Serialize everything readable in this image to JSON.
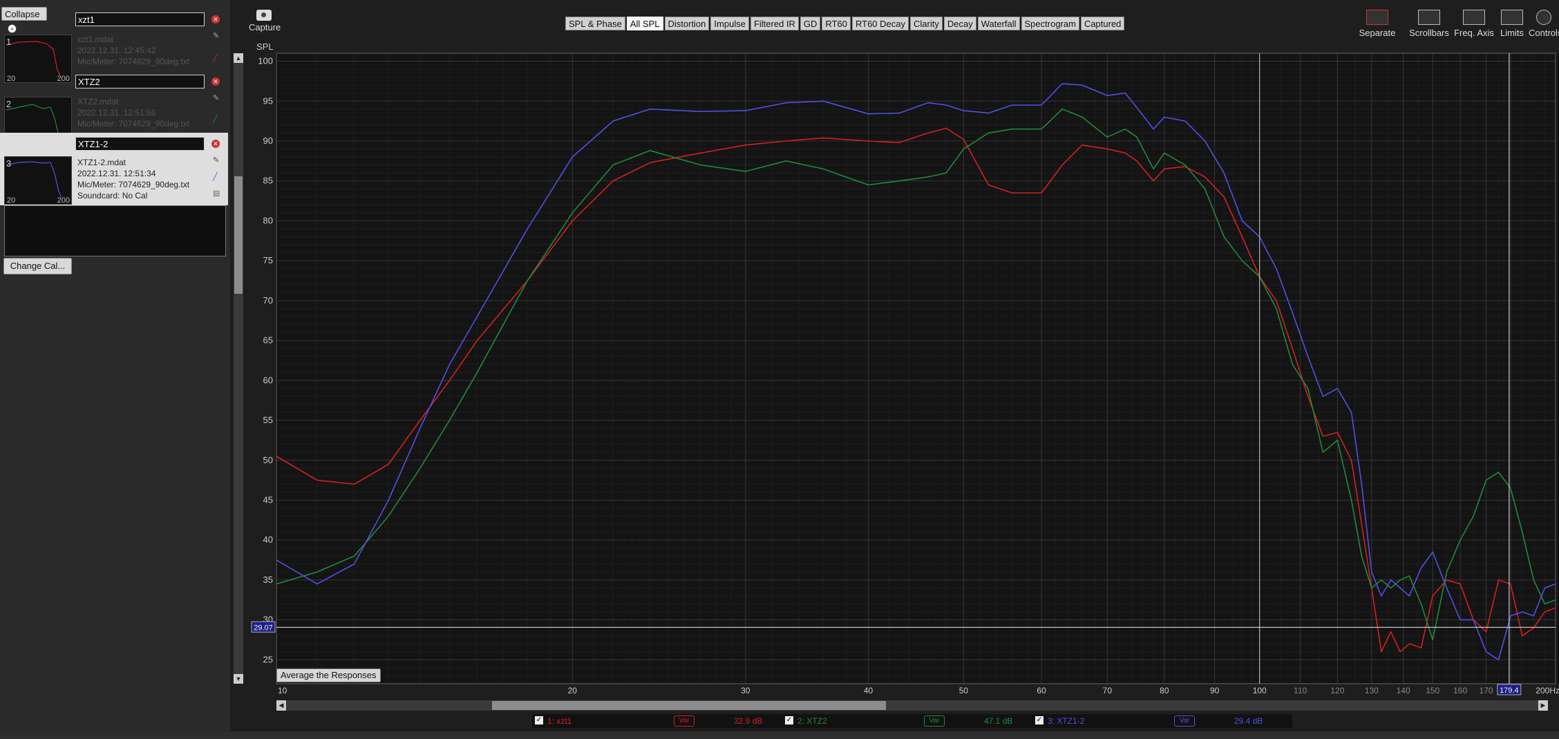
{
  "left_panel": {
    "collapse_label": "Collapse",
    "change_cal_label": "Change Cal...",
    "measurements": [
      {
        "num": "1",
        "name": "xzt1",
        "file": "xzt1.mdat",
        "date": "2022.12.31. 12:45:42",
        "mic": "Mic/Meter: 7074629_90deg.txt",
        "x_min": "20",
        "x_max": "200",
        "color": "#d42020"
      },
      {
        "num": "2",
        "name": "XTZ2",
        "file": "XTZ2.mdat",
        "date": "2022.12.31. 12:51:56",
        "mic": "Mic/Meter: 7074629_90deg.txt",
        "x_min": "20",
        "x_max": "200",
        "color": "#1f8a3c"
      },
      {
        "num": "3",
        "name": "XTZ1-2",
        "file": "XTZ1-2.mdat",
        "date": "2022.12.31. 12:51:34",
        "mic": "Mic/Meter: 7074629_90deg.txt",
        "soundcard": "Soundcard: No Cal",
        "x_min": "20",
        "x_max": "200",
        "color": "#5050e8"
      }
    ]
  },
  "toolbar": {
    "capture_label": "Capture",
    "tabs": [
      "SPL & Phase",
      "All SPL",
      "Distortion",
      "Impulse",
      "Filtered IR",
      "GD",
      "RT60",
      "RT60 Decay",
      "Clarity",
      "Decay",
      "Waterfall",
      "Spectrogram",
      "Captured"
    ],
    "active_tab": "All SPL",
    "right_tools": [
      "Separate",
      "Scrollbars",
      "Freq. Axis",
      "Limits",
      "Controls"
    ]
  },
  "graph": {
    "avg_button_label": "Average the Responses",
    "cursor_y_readout": "29.07",
    "cursor_x_readout": "179.4",
    "x_unit_label": "200Hz"
  },
  "legend": {
    "items": [
      {
        "label": "1: xzt1",
        "var_label": "Var",
        "value": "32.9 dB",
        "color": "#d42020"
      },
      {
        "label": "2: XTZ2",
        "var_label": "Var",
        "value": "47.1 dB",
        "color": "#1f8a3c"
      },
      {
        "label": "3: XTZ1-2",
        "var_label": "Var",
        "value": "29.4 dB",
        "color": "#5050e8"
      }
    ]
  },
  "chart_data": {
    "type": "line",
    "ylabel": "SPL",
    "xlabel": "",
    "x_scale": "log",
    "xlim": [
      10,
      200
    ],
    "ylim": [
      22,
      101
    ],
    "x_ticks": [
      10,
      20,
      30,
      40,
      50,
      60,
      70,
      80,
      90,
      100,
      110,
      120,
      130,
      140,
      150,
      160,
      170,
      180,
      200
    ],
    "x_tick_labels": [
      "10",
      "20",
      "30",
      "40",
      "50",
      "60",
      "70",
      "80",
      "90",
      "100",
      "110",
      "120",
      "130",
      "140",
      "150",
      "160",
      "170",
      "",
      "200Hz"
    ],
    "y_ticks": [
      25,
      30,
      35,
      40,
      45,
      50,
      55,
      60,
      65,
      70,
      75,
      80,
      85,
      90,
      95,
      100
    ],
    "grid": true,
    "series": [
      {
        "name": "1: xzt1",
        "color": "#d42020",
        "x": [
          10,
          11,
          12,
          13,
          14,
          15,
          16,
          18,
          20,
          22,
          24,
          27,
          30,
          33,
          36,
          40,
          43,
          46,
          48,
          50,
          53,
          56,
          60,
          63,
          66,
          70,
          73,
          75,
          78,
          80,
          84,
          88,
          92,
          96,
          100,
          104,
          108,
          112,
          116,
          120,
          124,
          127,
          130,
          133,
          136,
          139,
          142,
          146,
          150,
          155,
          160,
          165,
          170,
          175,
          180,
          185,
          190,
          195,
          200
        ],
        "y": [
          50.5,
          47.5,
          47.0,
          49.5,
          55.0,
          60.0,
          65.0,
          72.5,
          80.0,
          85.0,
          87.3,
          88.5,
          89.5,
          90.0,
          90.4,
          90.0,
          89.8,
          91.0,
          91.6,
          90.2,
          84.5,
          83.5,
          83.5,
          87.0,
          89.5,
          89.0,
          88.5,
          87.5,
          85.0,
          86.5,
          86.8,
          85.5,
          83.0,
          78.0,
          73.0,
          70.0,
          64.0,
          58.0,
          53.0,
          53.5,
          50.0,
          42.0,
          34.0,
          26.0,
          28.5,
          26.0,
          27.0,
          26.5,
          33.0,
          35.0,
          34.5,
          30.0,
          28.5,
          35.0,
          34.5,
          28.0,
          29.0,
          31.0,
          31.5
        ]
      },
      {
        "name": "2: XTZ2",
        "color": "#1f8a3c",
        "x": [
          10,
          11,
          12,
          13,
          14,
          15,
          16,
          18,
          20,
          22,
          24,
          27,
          30,
          33,
          36,
          40,
          43,
          46,
          48,
          50,
          53,
          56,
          60,
          63,
          66,
          70,
          73,
          75,
          78,
          80,
          84,
          88,
          92,
          96,
          100,
          104,
          108,
          112,
          116,
          120,
          124,
          127,
          130,
          133,
          136,
          139,
          142,
          146,
          150,
          155,
          160,
          165,
          170,
          175,
          180,
          185,
          190,
          195,
          200
        ],
        "y": [
          34.5,
          36.0,
          38.0,
          43.0,
          49.0,
          55.0,
          61.0,
          72.5,
          81.0,
          87.0,
          88.8,
          87.0,
          86.2,
          87.5,
          86.5,
          84.5,
          85.0,
          85.5,
          86.0,
          89.0,
          91.0,
          91.5,
          91.5,
          94.0,
          93.0,
          90.5,
          91.5,
          90.5,
          86.5,
          88.5,
          87.0,
          84.0,
          78.0,
          75.0,
          73.0,
          69.0,
          62.0,
          59.0,
          51.0,
          52.5,
          45.0,
          38.0,
          34.0,
          35.0,
          34.0,
          35.0,
          35.5,
          32.0,
          27.5,
          36.0,
          40.0,
          43.0,
          47.5,
          48.5,
          46.5,
          41.0,
          35.0,
          32.0,
          32.5
        ]
      },
      {
        "name": "3: XTZ1-2",
        "color": "#5050e8",
        "x": [
          10,
          11,
          12,
          13,
          14,
          15,
          16,
          18,
          20,
          22,
          24,
          27,
          30,
          33,
          36,
          40,
          43,
          46,
          48,
          50,
          53,
          56,
          60,
          63,
          66,
          70,
          73,
          75,
          78,
          80,
          84,
          88,
          92,
          96,
          100,
          104,
          108,
          112,
          116,
          120,
          124,
          127,
          130,
          133,
          136,
          139,
          142,
          146,
          150,
          155,
          160,
          165,
          170,
          175,
          180,
          185,
          190,
          195,
          200
        ],
        "y": [
          37.5,
          34.5,
          37.0,
          45.0,
          54.0,
          62.0,
          68.0,
          79.0,
          88.0,
          92.5,
          94.0,
          93.7,
          93.8,
          94.8,
          95.0,
          93.4,
          93.5,
          94.8,
          94.5,
          93.8,
          93.5,
          94.5,
          94.5,
          97.2,
          97.0,
          95.7,
          96.0,
          94.2,
          91.5,
          93.0,
          92.5,
          90.0,
          86.0,
          80.0,
          78.0,
          74.0,
          68.5,
          63.0,
          58.0,
          59.0,
          56.0,
          47.0,
          36.0,
          33.0,
          35.0,
          34.0,
          33.0,
          36.5,
          38.5,
          34.0,
          30.0,
          30.0,
          26.0,
          25.0,
          30.5,
          31.0,
          30.5,
          34.0,
          34.5
        ]
      }
    ]
  }
}
